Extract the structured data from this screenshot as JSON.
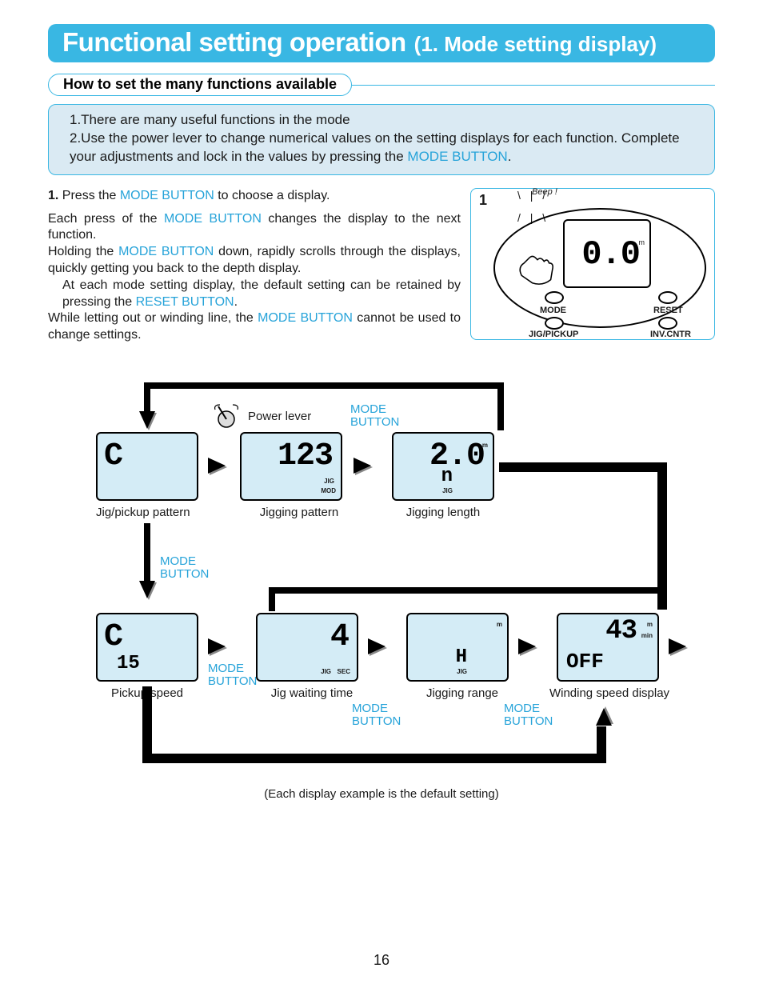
{
  "banner": {
    "main": "Functional setting operation",
    "sub": "(1. Mode setting display)"
  },
  "subhead": {
    "pill": "How to set the many functions available"
  },
  "box": {
    "line1": "1.There are many useful functions in the mode",
    "line2a": "2.Use the power lever to change numerical values on the setting displays for each function.  Complete your adjustments and lock in the values by pressing the ",
    "line2b": "MODE BUTTON",
    "line2c": "."
  },
  "instr": {
    "step1a": "1.",
    "step1b": " Press the ",
    "step1c": "MODE BUTTON",
    "step1d": " to choose a display.",
    "p2a": "Each press of the  ",
    "p2b": "MODE BUTTON",
    "p2c": " changes the display to the next function.",
    "p3a": "Holding the  ",
    "p3b": "MODE BUTTON",
    "p3c": " down, rapidly scrolls through the displays, quickly getting you back to the depth display.",
    "p4a": "At each mode setting display, the default setting can be retained by pressing the ",
    "p4b": "RESET BUTTON",
    "p4c": ".",
    "p5a": "While letting out or winding line, the  ",
    "p5b": "MODE BUTTON",
    "p5c": " cannot be used to change settings."
  },
  "fig1": {
    "num": "1",
    "beep": "Beep !",
    "lcd_big": "0.0",
    "lcd_unit": "m",
    "btn_mode": "MODE",
    "btn_reset": "RESET",
    "btn_jig": "JIG/PICKUP",
    "btn_inv": "INV.CNTR"
  },
  "flow": {
    "power_lever": "Power lever",
    "mode_button": "MODE\nBUTTON",
    "s_jigpickup": {
      "big": "C",
      "cap": "Jig/pickup pattern"
    },
    "s_jigpattern": {
      "big": "123",
      "tag1": "JIG",
      "tag2": "MOD",
      "cap": "Jigging pattern"
    },
    "s_jiglength": {
      "big": "2.0",
      "unit": "m",
      "mid": "n",
      "tag": "JIG",
      "cap": "Jigging length"
    },
    "s_pickup": {
      "big": "C",
      "mid": "15",
      "cap": "Pickup speed"
    },
    "s_wait": {
      "big": "4",
      "tag1": "JIG",
      "tag2": "SEC",
      "cap": "Jig waiting time"
    },
    "s_range": {
      "unit": "m",
      "mid": "H",
      "tag": "JIG",
      "cap": "Jigging range"
    },
    "s_wind": {
      "big": "43",
      "mid": "OFF",
      "u1": "m",
      "u2": "min",
      "cap": "Winding speed display"
    },
    "footnote": "(Each display example is the default setting)"
  },
  "page": "16"
}
